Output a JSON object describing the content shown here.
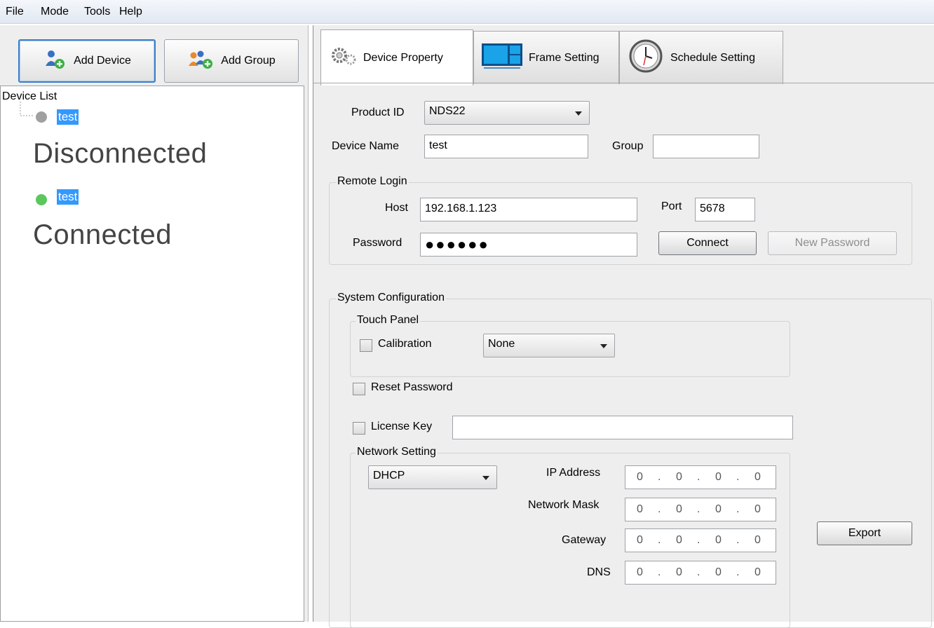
{
  "menu": [
    "File",
    "Mode",
    "Tools",
    "Help"
  ],
  "left": {
    "add_device_label": "Add Device",
    "add_group_label": "Add Group",
    "device_list_title": "Device List",
    "devices": [
      {
        "name": "test",
        "status_color": "#a0a0a0",
        "status_label": "Disconnected"
      },
      {
        "name": "test",
        "status_color": "#5cc75c",
        "status_label": "Connected"
      }
    ]
  },
  "tabs": [
    {
      "label": "Device Property",
      "selected": true,
      "icon": "gears-icon"
    },
    {
      "label": "Frame Setting",
      "selected": false,
      "icon": "frame-layout-icon"
    },
    {
      "label": "Schedule Setting",
      "selected": false,
      "icon": "clock-icon"
    }
  ],
  "device_property": {
    "product_id_label": "Product ID",
    "product_id_value": "NDS22",
    "device_name_label": "Device Name",
    "device_name_value": "test",
    "group_label": "Group",
    "group_value": "",
    "remote_login": {
      "title": "Remote Login",
      "host_label": "Host",
      "host_value": "192.168.1.123",
      "port_label": "Port",
      "port_value": "5678",
      "password_label": "Password",
      "password_value": "●●●●●●",
      "connect_label": "Connect",
      "new_password_label": "New Password"
    },
    "system_configuration": {
      "title": "System Configuration",
      "touch_panel_title": "Touch Panel",
      "calibration_label": "Calibration",
      "calibration_value": "None",
      "reset_password_label": "Reset Password",
      "license_key_label": "License Key",
      "license_key_value": "",
      "network_setting_title": "Network Setting",
      "network_mode": "DHCP",
      "ip_address_label": "IP Address",
      "network_mask_label": "Network Mask",
      "gateway_label": "Gateway",
      "dns_label": "DNS",
      "ip_octets": [
        "0",
        "0",
        "0",
        "0"
      ],
      "export_label": "Export"
    }
  },
  "colors": {
    "selection": "#3399ff",
    "panel_bg": "#eeeeee",
    "disconnected": "#a0a0a0",
    "connected": "#5cc75c"
  }
}
